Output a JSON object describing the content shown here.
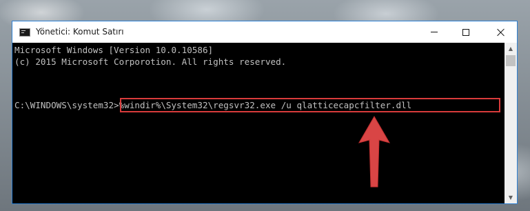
{
  "window": {
    "title": "Yönetici: Komut Satırı",
    "icon": "console-app-icon",
    "controls": {
      "minimize": "minimize-icon",
      "maximize": "maximize-icon",
      "close": "close-icon"
    }
  },
  "console": {
    "lines": [
      "Microsoft Windows [Version 10.0.10586]",
      "(c) 2015 Microsoft Corporotion. All rights reserved."
    ],
    "prompt": "C:\\WINDOWS\\system32>",
    "command": "%windir%\\System32\\regsvr32.exe /u qlatticecapcfilter.dll"
  },
  "colors": {
    "titlebar": "#ffffff",
    "console_bg": "#000000",
    "console_text": "#c0c0c0",
    "highlight": "#d93b3b",
    "window_border": "#2c7fd3"
  },
  "annotations": {
    "highlight_target": "command",
    "arrow_icon": "red-arrow-up-icon"
  }
}
